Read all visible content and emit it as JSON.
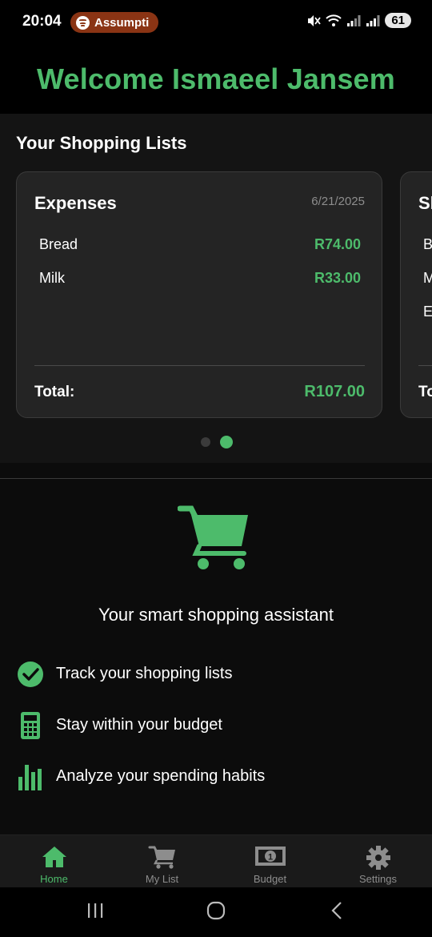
{
  "status_bar": {
    "time": "20:04",
    "media_pill": {
      "app_icon": "spotify-icon",
      "text": "Assumpti",
      "color": "#8a3414"
    },
    "icons": [
      "mute-icon",
      "wifi-icon",
      "signal-icon",
      "signal-icon"
    ],
    "battery": "61"
  },
  "header": {
    "title": "Welcome Ismaeel Jansem"
  },
  "shopping_lists": {
    "title": "Your Shopping Lists",
    "cards": [
      {
        "title": "Expenses",
        "date": "6/21/2025",
        "items": [
          {
            "name": "Bread",
            "price": "R74.00"
          },
          {
            "name": "Milk",
            "price": "R33.00"
          }
        ],
        "total_label": "Total:",
        "total_value": "R107.00"
      },
      {
        "title_partial": "Sl",
        "items_partial": [
          "B",
          "M",
          "Eg"
        ],
        "total_partial": "To"
      }
    ],
    "pager": {
      "count": 2,
      "active_index": 1
    }
  },
  "assistant": {
    "icon": "shopping-cart-icon",
    "tagline": "Your smart shopping assistant",
    "features": [
      {
        "icon": "check-circle-icon",
        "label": "Track your shopping lists"
      },
      {
        "icon": "calculator-icon",
        "label": "Stay within your budget"
      },
      {
        "icon": "bar-chart-icon",
        "label": "Analyze your spending habits"
      }
    ]
  },
  "tab_bar": {
    "tabs": [
      {
        "label": "Home",
        "icon": "home-icon",
        "active": true
      },
      {
        "label": "My List",
        "icon": "cart-icon",
        "active": false
      },
      {
        "label": "Budget",
        "icon": "money-icon",
        "active": false
      },
      {
        "label": "Settings",
        "icon": "gear-icon",
        "active": false
      }
    ]
  },
  "nav_bar": {
    "buttons": [
      "recents-icon",
      "home-circle-icon",
      "back-icon"
    ]
  },
  "colors": {
    "accent": "#4dbb6b",
    "card_bg": "#242424",
    "inactive": "#8d8d8d"
  }
}
